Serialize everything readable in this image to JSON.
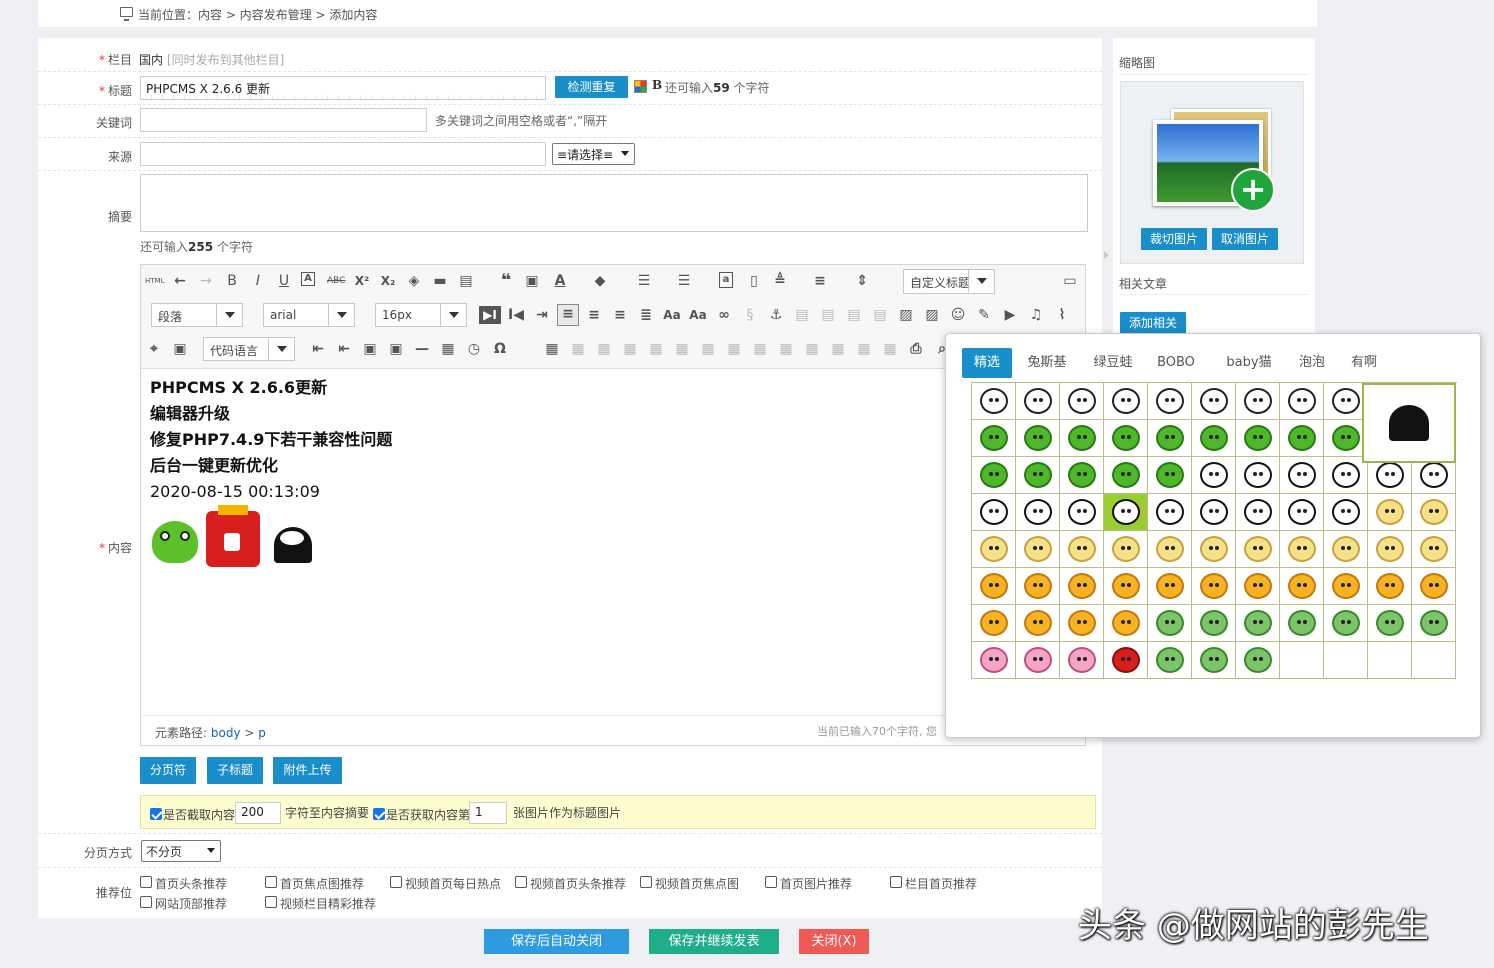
{
  "breadcrumb": "当前位置：内容 > 内容发布管理 > 添加内容",
  "form": {
    "category": {
      "label": "栏目",
      "value": "国内",
      "extra": "[同时发布到其他栏目]"
    },
    "title": {
      "label": "标题",
      "value": "PHPCMS X 2.6.6 更新",
      "check_button": "检测重复",
      "remaining_prefix": "还可输入",
      "remaining_count": "59",
      "remaining_suffix": "个字符"
    },
    "keywords": {
      "label": "关键词",
      "value": "",
      "hint": "多关键词之间用空格或者“,”隔开"
    },
    "source": {
      "label": "来源",
      "value": "",
      "select": "≡请选择≡"
    },
    "summary": {
      "label": "摘要",
      "value": "",
      "remaining_prefix": "还可输入",
      "remaining_count": "255",
      "remaining_suffix": "个字符"
    },
    "content": {
      "label": "内容"
    }
  },
  "toolbar": {
    "paragraph": "段落",
    "font": "arial",
    "size": "16px",
    "custom_title": "自定义标题",
    "code_lang": "代码语言",
    "html_label": "HTML"
  },
  "editor_content": {
    "lines": [
      "PHPCMS X 2.6.6更新",
      "编辑器升级",
      "修复PHP7.4.9下若干兼容性问题",
      "后台一键更新优化"
    ],
    "date": "2020-08-15 00:13:09",
    "path_label": "元素路径:",
    "path_body": "body",
    "path_sep": ">",
    "path_p": "p",
    "count_text": "当前已输入70个字符, 您"
  },
  "editor_buttons": [
    "分页符",
    "子标题",
    "附件上传"
  ],
  "autoext": {
    "cut_label": "是否截取内容",
    "cut_value": "200",
    "cut_suffix": "字符至内容摘要",
    "img_label": "是否获取内容第",
    "img_value": "1",
    "img_suffix": "张图片作为标题图片"
  },
  "paging": {
    "label": "分页方式",
    "value": "不分页"
  },
  "positions": {
    "label": "推荐位",
    "items": [
      "首页头条推荐",
      "首页焦点图推荐",
      "视频首页每日热点",
      "视频首页头条推荐",
      "视频首页焦点图",
      "首页图片推荐",
      "栏目首页推荐",
      "网站顶部推荐",
      "视频栏目精彩推荐"
    ]
  },
  "sidebar": {
    "thumb_title": "缩略图",
    "crop_button": "裁切图片",
    "cancel_button": "取消图片",
    "related_title": "相关文章",
    "add_related": "添加相关"
  },
  "emoji_tabs": [
    "精选",
    "兔斯基",
    "绿豆蛙",
    "BOBO",
    "baby猫",
    "泡泡",
    "有啊"
  ],
  "bottom_buttons": {
    "save_close": "保存后自动关闭",
    "save_continue": "保存并继续发表",
    "close": "关闭(X)"
  },
  "watermark": "头条 @做网站的彭先生",
  "colors": {
    "blue": "#1a8ec9",
    "green": "#1fae8a",
    "red": "#f05a55"
  }
}
